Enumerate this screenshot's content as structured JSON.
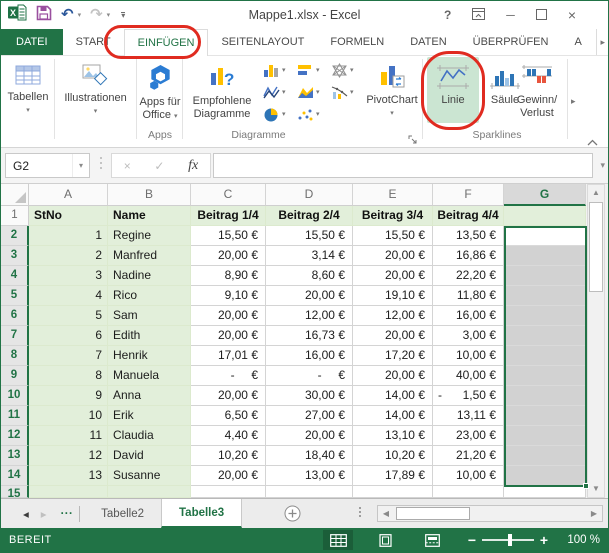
{
  "titlebar": {
    "title": "Mappe1.xlsx - Excel",
    "help_glyph": "?",
    "minimize_glyph": "─",
    "close_glyph": "×",
    "undo_glyph": "↶",
    "redo_glyph": "↷",
    "dropdown_glyph": "▾"
  },
  "ribbon_tabs": [
    {
      "label": "DATEI",
      "file": true
    },
    {
      "label": "START"
    },
    {
      "label": "EINFÜGEN",
      "active": true
    },
    {
      "label": "SEITENLAYOUT"
    },
    {
      "label": "FORMELN"
    },
    {
      "label": "DATEN"
    },
    {
      "label": "ÜBERPRÜFEN"
    },
    {
      "label": "A"
    }
  ],
  "tab_scroll_glyph": "▸",
  "ribbon": {
    "tabellen": "Tabellen",
    "illustrationen": "Illustrationen",
    "apps_line1": "Apps für",
    "apps_line2": "Office",
    "apps_group": "Apps",
    "empfohlene_line1": "Empfohlene",
    "empfohlene_line2": "Diagramme",
    "pivotchart": "PivotChart",
    "diagramme_group": "Diagramme",
    "linie": "Linie",
    "saeule": "Säule",
    "gewinn_line1": "Gewinn/",
    "gewinn_line2": "Verlust",
    "sparklines_group": "Sparklines",
    "dropdown_glyph": "▾",
    "scroll_glyph": "▸"
  },
  "formula_bar": {
    "name_box": "G2",
    "cancel_glyph": "×",
    "enter_glyph": "✓",
    "fx": "fx",
    "value": "",
    "dropdown_glyph": "▾",
    "expand_glyph": "▾"
  },
  "grid": {
    "column_headers": [
      "A",
      "B",
      "C",
      "D",
      "E",
      "F",
      "G"
    ],
    "selected_column": "G",
    "active_cell": "G2",
    "rows": {
      "header": [
        "StNo",
        "Name",
        "Beitrag 1/4",
        "Beitrag 2/4",
        "Beitrag 3/4",
        "Beitrag 4/4"
      ],
      "data": [
        [
          "1",
          "Regine",
          "15,50 €",
          "15,50 €",
          "15,50 €",
          "13,50 €"
        ],
        [
          "2",
          "Manfred",
          "20,00 €",
          "3,14 €",
          "20,00 €",
          "16,86 €"
        ],
        [
          "3",
          "Nadine",
          "8,90 €",
          "8,60 €",
          "20,00 €",
          "22,20 €"
        ],
        [
          "4",
          "Rico",
          "9,10 €",
          "20,00 €",
          "19,10 €",
          "11,80 €"
        ],
        [
          "5",
          "Sam",
          "20,00 €",
          "12,00 €",
          "12,00 €",
          "16,00 €"
        ],
        [
          "6",
          "Edith",
          "20,00 €",
          "16,73 €",
          "20,00 €",
          "3,00 €"
        ],
        [
          "7",
          "Henrik",
          "17,01 €",
          "16,00 €",
          "17,20 €",
          "10,00 €"
        ],
        [
          "8",
          "Manuela",
          "- €",
          "- €",
          "20,00 €",
          "40,00 €"
        ],
        [
          "9",
          "Anna",
          "20,00 €",
          "30,00 €",
          "14,00 €",
          "-1,50 €"
        ],
        [
          "10",
          "Erik",
          "6,50 €",
          "27,00 €",
          "14,00 €",
          "13,11 €"
        ],
        [
          "11",
          "Claudia",
          "4,40 €",
          "20,00 €",
          "13,10 €",
          "23,00 €"
        ],
        [
          "12",
          "David",
          "10,20 €",
          "18,40 €",
          "10,20 €",
          "21,20 €"
        ],
        [
          "13",
          "Susanne",
          "20,00 €",
          "13,00 €",
          "17,89 €",
          "10,00 €"
        ]
      ],
      "last_row_number": "15"
    }
  },
  "sheet_bar": {
    "nav_left_glyph": "◂",
    "nav_right_glyph": "▸",
    "more_sheets": "...",
    "tabs": [
      {
        "label": "Tabelle2",
        "active": false
      },
      {
        "label": "Tabelle3",
        "active": true
      }
    ]
  },
  "status_bar": {
    "mode": "BEREIT",
    "zoom_out_glyph": "−",
    "zoom_in_glyph": "+",
    "zoom_level": "100 %"
  },
  "colors": {
    "accent_green": "#217346",
    "annotation_red": "#E02B20",
    "cell_fill_green": "#E2EFDA",
    "selection_gray": "#D2D2D2",
    "sparkline_highlight": "#CBE5D2"
  }
}
